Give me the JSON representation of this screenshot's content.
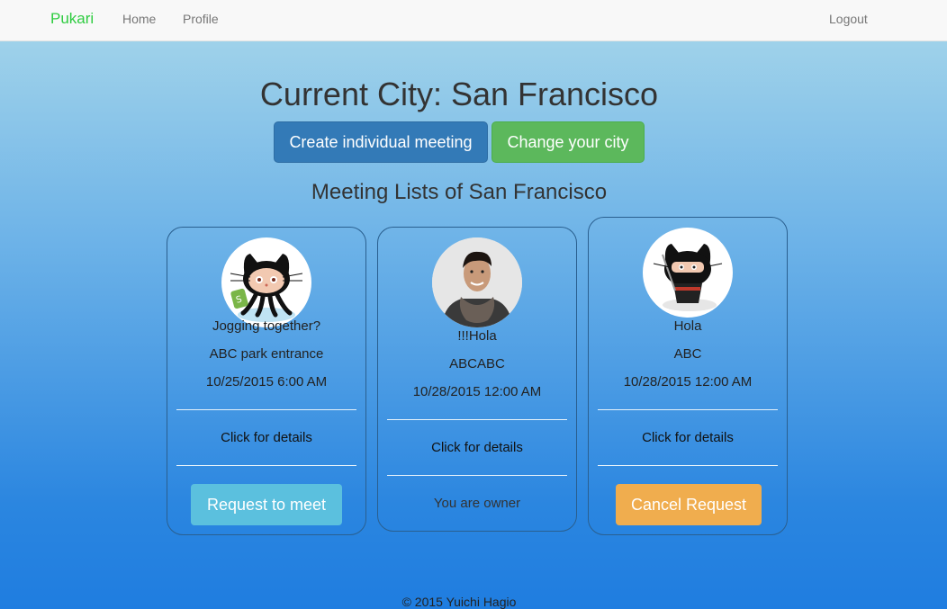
{
  "nav": {
    "brand": "Pukari",
    "home": "Home",
    "profile": "Profile",
    "logout": "Logout"
  },
  "header": {
    "title": "Current City: San Francisco",
    "create_button": "Create individual meeting",
    "change_button": "Change your city",
    "section_title": "Meeting Lists of San Francisco"
  },
  "meetings": [
    {
      "title": "Jogging together?",
      "place": "ABC park entrance",
      "datetime": "10/25/2015 6:00 AM",
      "details": "Click for details",
      "action": "Request to meet"
    },
    {
      "title": "!!!Hola",
      "place": "ABCABC",
      "datetime": "10/28/2015 12:00 AM",
      "details": "Click for details",
      "status": "You are owner"
    },
    {
      "title": "Hola",
      "place": "ABC",
      "datetime": "10/28/2015 12:00 AM",
      "details": "Click for details",
      "action": "Cancel Request"
    }
  ],
  "footer": "© 2015 Yuichi Hagio",
  "colors": {
    "primary": "#337ab7",
    "success": "#5cb85c",
    "info": "#5bc0de",
    "warning": "#f0ad4e",
    "brand": "#2ecc40"
  }
}
